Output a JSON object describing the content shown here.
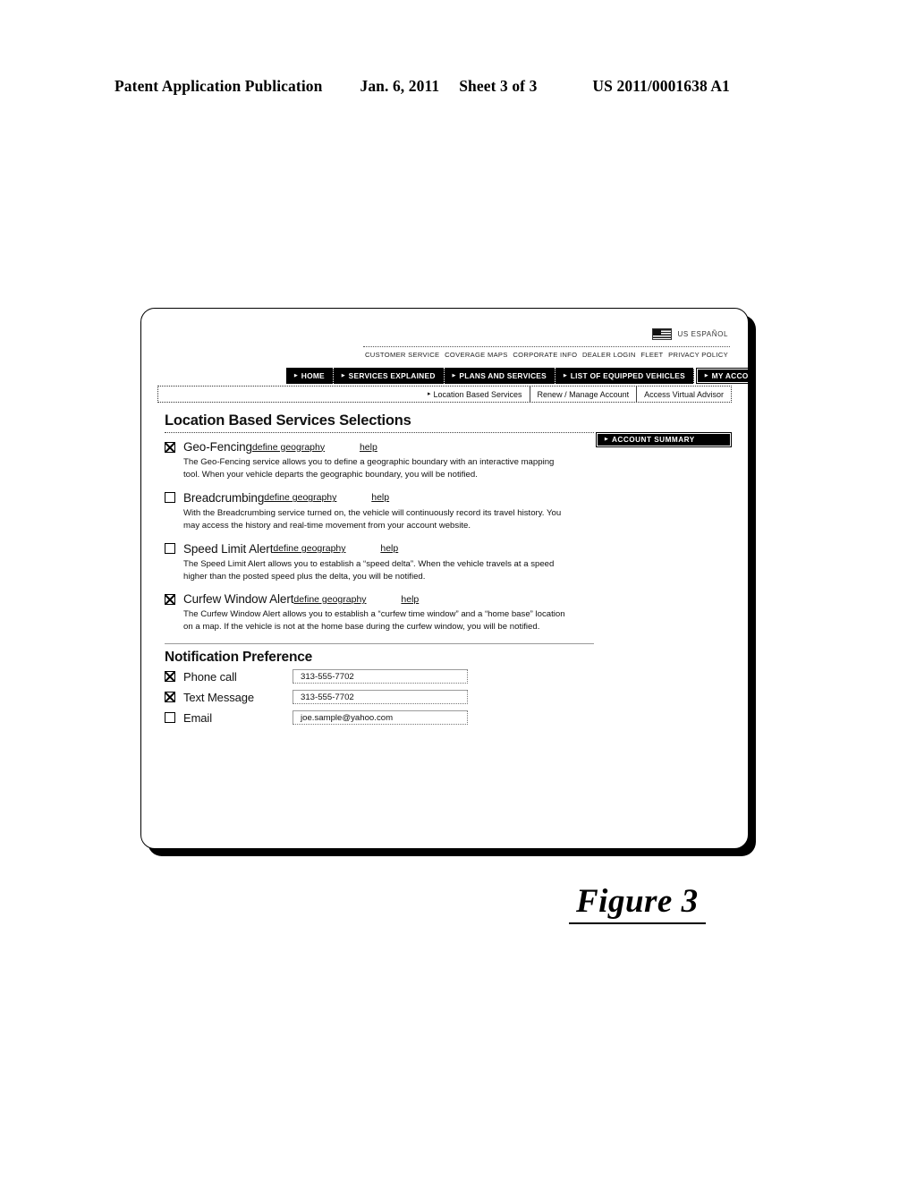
{
  "patent_header": {
    "publication": "Patent Application Publication",
    "date": "Jan. 6, 2011",
    "sheet": "Sheet 3 of 3",
    "number": "US 2011/0001638 A1"
  },
  "figure_caption": "Figure 3",
  "browser": {
    "locale": {
      "flag_icon": "us-flag-icon",
      "label": "US  ESPAÑOL"
    },
    "utility_nav": [
      {
        "label": "CUSTOMER SERVICE"
      },
      {
        "label": "COVERAGE MAPS"
      },
      {
        "label": "CORPORATE INFO"
      },
      {
        "label": "DEALER LOGIN"
      },
      {
        "label": "FLEET"
      },
      {
        "label": "PRIVACY POLICY"
      }
    ],
    "main_nav": [
      {
        "label": "HOME",
        "arrow": "▸",
        "active": false
      },
      {
        "label": "SERVICES EXPLAINED",
        "arrow": "▸",
        "active": false
      },
      {
        "label": "PLANS AND SERVICES",
        "arrow": "▸",
        "active": false
      },
      {
        "label": "LIST OF EQUIPPED VEHICLES",
        "arrow": "▸",
        "active": false
      },
      {
        "label": "MY ACCOUNT",
        "arrow": "▸",
        "active": true
      }
    ],
    "sub_nav": [
      {
        "label": "Location Based Services",
        "arrow": "▸",
        "selected": true
      },
      {
        "label": "Renew / Manage Account",
        "arrow": "",
        "selected": false
      },
      {
        "label": "Access Virtual Advisor",
        "arrow": "",
        "selected": false
      }
    ],
    "sidebar": {
      "account_summary": {
        "label": "ACCOUNT SUMMARY",
        "arrow": "▸"
      }
    },
    "page": {
      "title": "Location Based Services Selections",
      "services": [
        {
          "name": "Geo-Fencing",
          "checked": true,
          "define_link": "define geography",
          "help_link": "help",
          "description": "The Geo-Fencing service allows you to define a geographic boundary with an interactive mapping tool.  When your vehicle departs the geographic boundary, you will be notified."
        },
        {
          "name": "Breadcrumbing",
          "checked": false,
          "define_link": "define geography",
          "help_link": "help",
          "description": "With the Breadcrumbing service turned on, the vehicle will continuously record its travel history. You may access the history and real-time movement from your account website."
        },
        {
          "name": "Speed Limit Alert",
          "checked": false,
          "define_link": "define geography",
          "help_link": "help",
          "description": "The Speed Limit Alert allows you to establish a “speed delta”. When the vehicle travels at a speed higher than the posted speed plus the delta, you will be notified."
        },
        {
          "name": "Curfew Window Alert",
          "checked": true,
          "define_link": "define geography",
          "help_link": "help",
          "description": "The Curfew Window Alert allows you to establish a “curfew time window” and a “home base” location on a map. If the vehicle is not at the home base during the curfew window, you will be notified."
        }
      ],
      "notification": {
        "title": "Notification Preference",
        "rows": [
          {
            "label": "Phone call",
            "checked": true,
            "value": "313-555-7702"
          },
          {
            "label": "Text Message",
            "checked": true,
            "value": "313-555-7702"
          },
          {
            "label": "Email",
            "checked": false,
            "value": "joe.sample@yahoo.com"
          }
        ]
      }
    }
  }
}
